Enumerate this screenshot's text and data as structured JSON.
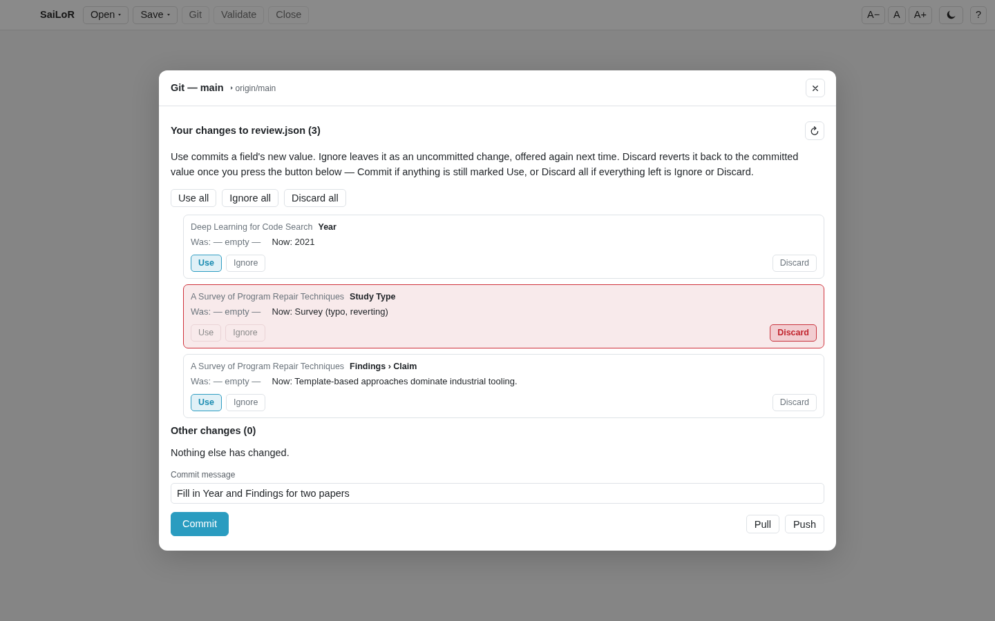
{
  "toolbar": {
    "app_name": "SaiLoR",
    "buttons": [
      {
        "label": "Open",
        "dropdown": true,
        "disabled": false
      },
      {
        "label": "Save",
        "dropdown": true,
        "disabled": false
      },
      {
        "label": "Git",
        "dropdown": false,
        "disabled": true
      },
      {
        "label": "Validate",
        "dropdown": false,
        "disabled": true
      },
      {
        "label": "Close",
        "dropdown": false,
        "disabled": true
      }
    ],
    "font_size_buttons": [
      "A−",
      "A",
      "A+"
    ],
    "help_button": "?"
  },
  "dialog": {
    "title": "Git — main",
    "upstream": "origin/main",
    "changes_heading": "Your changes to review.json (3)",
    "description": "Use commits a field's new value. Ignore leaves it as an uncommitted change, offered again next time. Discard reverts it back to the committed value once you press the button below — Commit if anything is still marked Use, or Discard all if everything left is Ignore or Discard.",
    "bulk_buttons": [
      "Use all",
      "Ignore all",
      "Discard all"
    ],
    "changes": [
      {
        "paper": "Deep Learning for Code Search",
        "field": "Year",
        "was": "Was: — empty —",
        "now": "Now: 2021",
        "actions": [
          {
            "kind": "use",
            "label": "Use",
            "selected": true
          },
          {
            "kind": "ignore",
            "label": "Ignore",
            "selected": false
          },
          {
            "kind": "discard",
            "label": "Discard",
            "selected": false
          }
        ]
      },
      {
        "paper": "A Survey of Program Repair Techniques",
        "field": "Study Type",
        "was": "Was: — empty —",
        "now": "Now: Survey (typo, reverting)",
        "actions": [
          {
            "kind": "use",
            "label": "Use",
            "selected": false
          },
          {
            "kind": "ignore",
            "label": "Ignore",
            "selected": false
          },
          {
            "kind": "discard",
            "label": "Discard",
            "selected": true
          }
        ]
      },
      {
        "paper": "A Survey of Program Repair Techniques",
        "field": "Findings › Claim",
        "was": "Was: — empty —",
        "now": "Now: Template-based approaches dominate industrial tooling.",
        "actions": [
          {
            "kind": "use",
            "label": "Use",
            "selected": true
          },
          {
            "kind": "ignore",
            "label": "Ignore",
            "selected": false
          },
          {
            "kind": "discard",
            "label": "Discard",
            "selected": false
          }
        ]
      }
    ],
    "other_heading": "Other changes (0)",
    "other_text": "Nothing else has changed.",
    "commit_message": {
      "label": "Commit message",
      "value": "Fill in Year and Findings for two papers"
    },
    "commit_button": "Commit",
    "remote_buttons": [
      "Pull",
      "Push"
    ]
  }
}
